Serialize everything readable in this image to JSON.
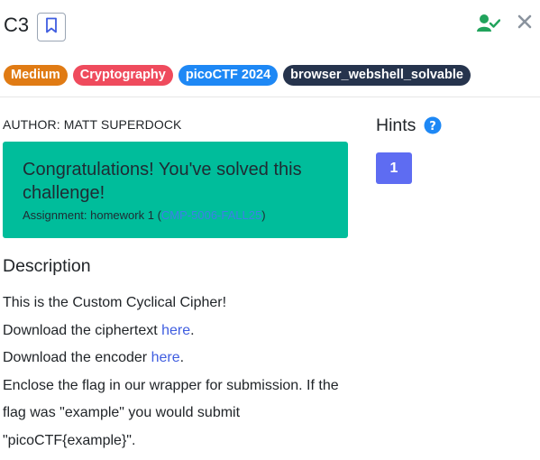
{
  "challenge": {
    "title": "C3"
  },
  "tags": [
    {
      "label": "Medium",
      "color": "#e07b14"
    },
    {
      "label": "Cryptography",
      "color": "#ef4b5d"
    },
    {
      "label": "picoCTF 2024",
      "color": "#1e88f5"
    },
    {
      "label": "browser_webshell_solvable",
      "color": "#26344d"
    }
  ],
  "author": "AUTHOR: MATT SUPERDOCK",
  "solved": {
    "message": "Congratulations! You've solved this challenge!",
    "assignment_prefix": "Assignment: homework 1 (",
    "course": "CMP-5006-FALL25",
    "assignment_suffix": ")",
    "bg_color": "#00bd9b"
  },
  "description": {
    "heading": "Description",
    "line1": "This is the Custom Cyclical Cipher!",
    "line2_prefix": "Download the ciphertext ",
    "line2_link": "here",
    "line2_suffix": ".",
    "line3_prefix": "Download the encoder ",
    "line3_link": "here",
    "line3_suffix": ".",
    "line4": "Enclose the flag in our wrapper for submission. If the flag was \"example\" you would submit \"picoCTF{example}\"."
  },
  "hints": {
    "label": "Hints",
    "button": "1",
    "help_icon": "question-circle-icon"
  },
  "icons": {
    "bookmark": "bookmark-icon",
    "solved_user": "user-check-icon",
    "close": "close-icon"
  }
}
